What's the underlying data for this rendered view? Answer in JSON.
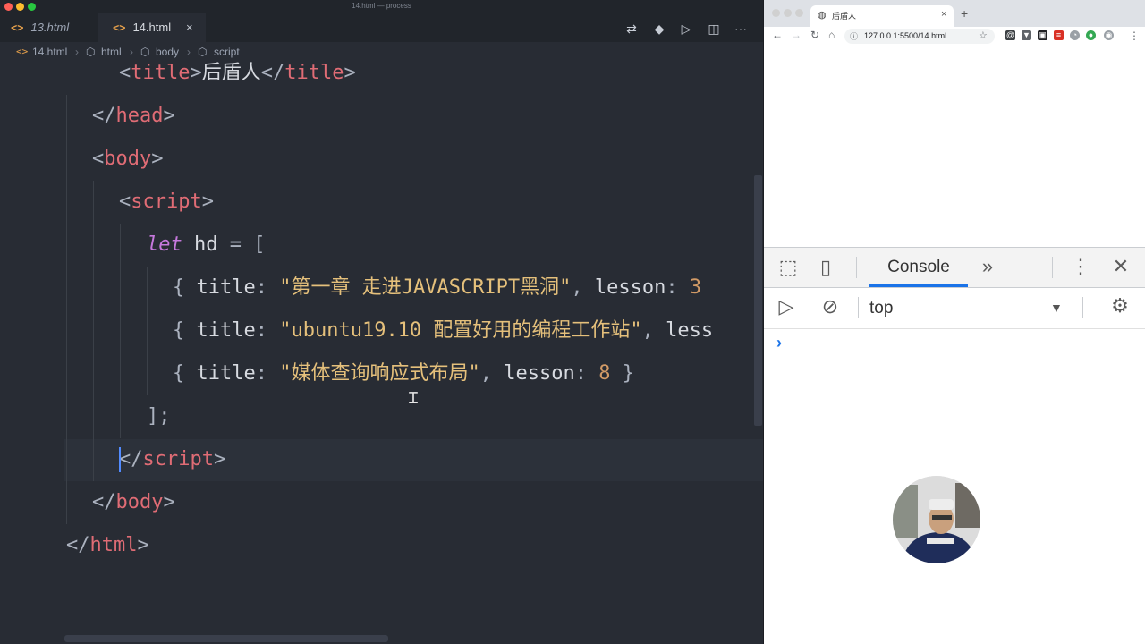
{
  "window": {
    "title": "14.html — process"
  },
  "editor": {
    "tabs": [
      {
        "label": "13.html",
        "active": false
      },
      {
        "label": "14.html",
        "active": true
      }
    ],
    "tab_close_glyph": "×",
    "more_glyph": "···",
    "breadcrumb": [
      "14.html",
      "html",
      "body",
      "script"
    ],
    "code": {
      "line1": {
        "open": "<",
        "tag": "title",
        "close": ">",
        "text": "后盾人",
        "open2": "</",
        "tag2": "title",
        "close2": ">"
      },
      "line2": {
        "open": "</",
        "tag": "head",
        "close": ">"
      },
      "line3": {
        "open": "<",
        "tag": "body",
        "close": ">"
      },
      "line4": {
        "open": "<",
        "tag": "script",
        "close": ">"
      },
      "line5": {
        "kw": "let",
        "ident": "hd",
        "op": "=",
        "bracket": "["
      },
      "rows": [
        {
          "brace": "{",
          "key": "title",
          "colon": ":",
          "value": "\"第一章 走进JAVASCRIPT黑洞\"",
          "comma": ",",
          "key2": "lesson",
          "colon2": ":",
          "num": "3",
          "end": ""
        },
        {
          "brace": "{",
          "key": "title",
          "colon": ":",
          "value": "\"ubuntu19.10 配置好用的编程工作站\"",
          "comma": ",",
          "key2": "less",
          "colon2": "",
          "num": "",
          "end": ""
        },
        {
          "brace": "{",
          "key": "title",
          "colon": ":",
          "value": "\"媒体查询响应式布局\"",
          "comma": ",",
          "key2": "lesson",
          "colon2": ":",
          "num": "8",
          "end": "}"
        }
      ],
      "line9": {
        "text": "];"
      },
      "line10": {
        "open": "</",
        "tag": "script",
        "close": ">"
      },
      "line11": {
        "open": "</",
        "tag": "body",
        "close": ">"
      },
      "line12": {
        "open": "</",
        "tag": "html",
        "close": ">"
      }
    }
  },
  "browser": {
    "tab_title": "后盾人",
    "tab_close": "×",
    "new_tab": "+",
    "url": "127.0.0.1:5500/14.html",
    "devtools": {
      "active_tab": "Console",
      "more_tabs": "»",
      "context": "top",
      "prompt": "›"
    }
  }
}
